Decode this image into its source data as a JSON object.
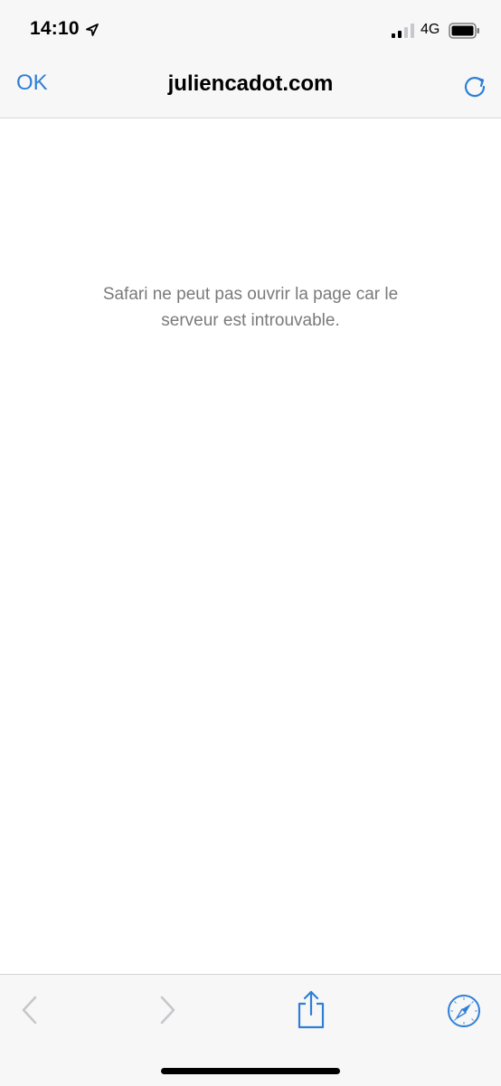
{
  "status_bar": {
    "time": "14:10",
    "network": "4G",
    "icons": [
      "location-arrow-icon",
      "signal-bars-icon",
      "battery-icon"
    ]
  },
  "nav": {
    "done_label": "OK",
    "title": "juliencadot.com",
    "reload_icon": "reload-icon"
  },
  "content": {
    "error_message": "Safari ne peut pas ouvrir la page car le serveur est introuvable."
  },
  "toolbar": {
    "buttons": [
      "back-icon",
      "forward-icon",
      "share-icon",
      "compass-icon"
    ]
  },
  "colors": {
    "accent": "#2f7fd6",
    "bar_background": "#f7f7f7",
    "message_text": "#7a7a7a",
    "disabled": "#c7c7cc"
  }
}
